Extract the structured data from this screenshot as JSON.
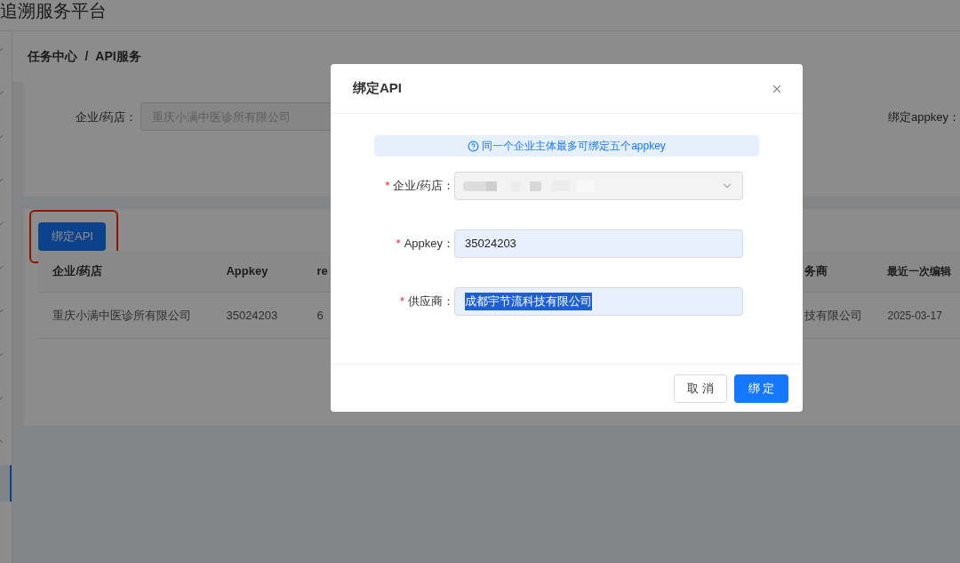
{
  "header": {
    "title": "追溯服务平台"
  },
  "sidebar": {
    "items": [
      {
        "expanded": false
      },
      {
        "expanded": false
      },
      {
        "expanded": false
      },
      {
        "expanded": false
      },
      {
        "expanded": false
      },
      {
        "expanded": false
      },
      {
        "expanded": false
      },
      {
        "expanded": false
      },
      {
        "expanded": false
      },
      {
        "expanded": true,
        "children": [
          {
            "selected": true
          }
        ]
      }
    ]
  },
  "breadcrumb": {
    "items": [
      "任务中心",
      "API服务"
    ],
    "separator": "/"
  },
  "filters": {
    "company": {
      "label": "企业/药店：",
      "placeholder": "重庆小满中医诊所有限公司"
    },
    "appkey_label": "绑定appkey："
  },
  "bind_button": {
    "label": "绑定API",
    "highlighted": true
  },
  "table": {
    "columns": [
      "企业/药店",
      "Appkey",
      "re",
      "务商",
      "最近一次编辑"
    ],
    "rows": [
      [
        "重庆小满中医诊所有限公司",
        "35024203",
        "6",
        "技有限公司",
        "2025-03-17"
      ]
    ]
  },
  "dialog": {
    "title": "绑定API",
    "tip": "同一个企业主体最多可绑定五个appkey",
    "fields": [
      {
        "kind": "select",
        "label": "企业/药店：",
        "required_mark": "*",
        "blurred": true
      },
      {
        "kind": "input",
        "label": "Appkey：",
        "required_mark": "*",
        "value": "35024203",
        "text_selected": false
      },
      {
        "kind": "input",
        "label": "供应商：",
        "required_mark": "*",
        "value": "成都宇节流科技有限公司",
        "text_selected": true
      }
    ],
    "buttons": [
      {
        "label": "取 消",
        "kind": "default"
      },
      {
        "label": "绑 定",
        "kind": "primary"
      }
    ]
  }
}
